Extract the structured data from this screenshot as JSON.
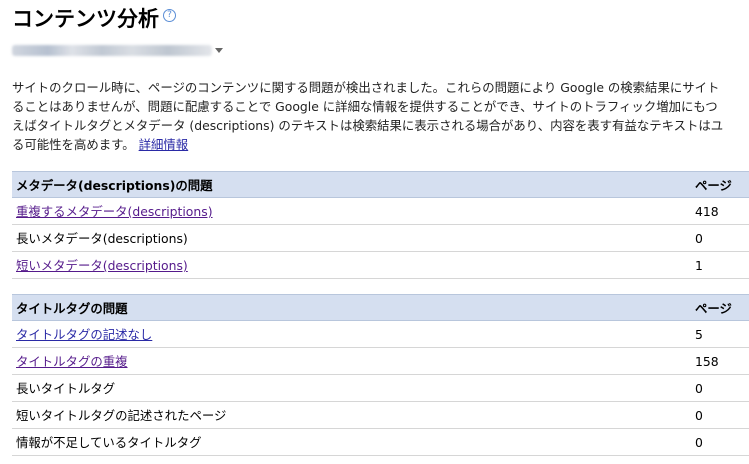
{
  "header": {
    "title": "コンテンツ分析",
    "help_icon": "question-circle-icon"
  },
  "site_selector": {
    "icon": "dropdown-arrow-icon"
  },
  "description": {
    "line1": "サイトのクロール時に、ページのコンテンツに関する問題が検出されました。これらの問題により Google の検索結果にサイト",
    "line2": "ることはありませんが、問題に配慮することで Google に詳細な情報を提供することができ、サイトのトラフィック増加にもつ",
    "line3": "えばタイトルタグとメタデータ (descriptions) のテキストは検索結果に表示される場合があり、内容を表す有益なテキストはユ",
    "line4": "る可能性を高めます。",
    "more_link": "詳細情報"
  },
  "meta_table": {
    "header_label": "メタデータ(descriptions)の問題",
    "header_pages": "ページ",
    "rows": [
      {
        "label": "重複するメタデータ(descriptions)",
        "pages": "418",
        "link": true
      },
      {
        "label": "長いメタデータ(descriptions)",
        "pages": "0",
        "link": false
      },
      {
        "label": "短いメタデータ(descriptions)",
        "pages": "1",
        "link": true
      }
    ]
  },
  "title_table": {
    "header_label": "タイトルタグの問題",
    "header_pages": "ページ",
    "rows": [
      {
        "label": "タイトルタグの記述なし",
        "pages": "5",
        "link": true
      },
      {
        "label": "タイトルタグの重複",
        "pages": "158",
        "link": true
      },
      {
        "label": "長いタイトルタグ",
        "pages": "0",
        "link": false
      },
      {
        "label": "短いタイトルタグの記述されたページ",
        "pages": "0",
        "link": false
      },
      {
        "label": "情報が不足しているタイトルタグ",
        "pages": "0",
        "link": false
      }
    ]
  },
  "colors": {
    "header_bg": "#d5dff0",
    "link": "#2a2aa6",
    "visited_link": "#551a8b"
  }
}
